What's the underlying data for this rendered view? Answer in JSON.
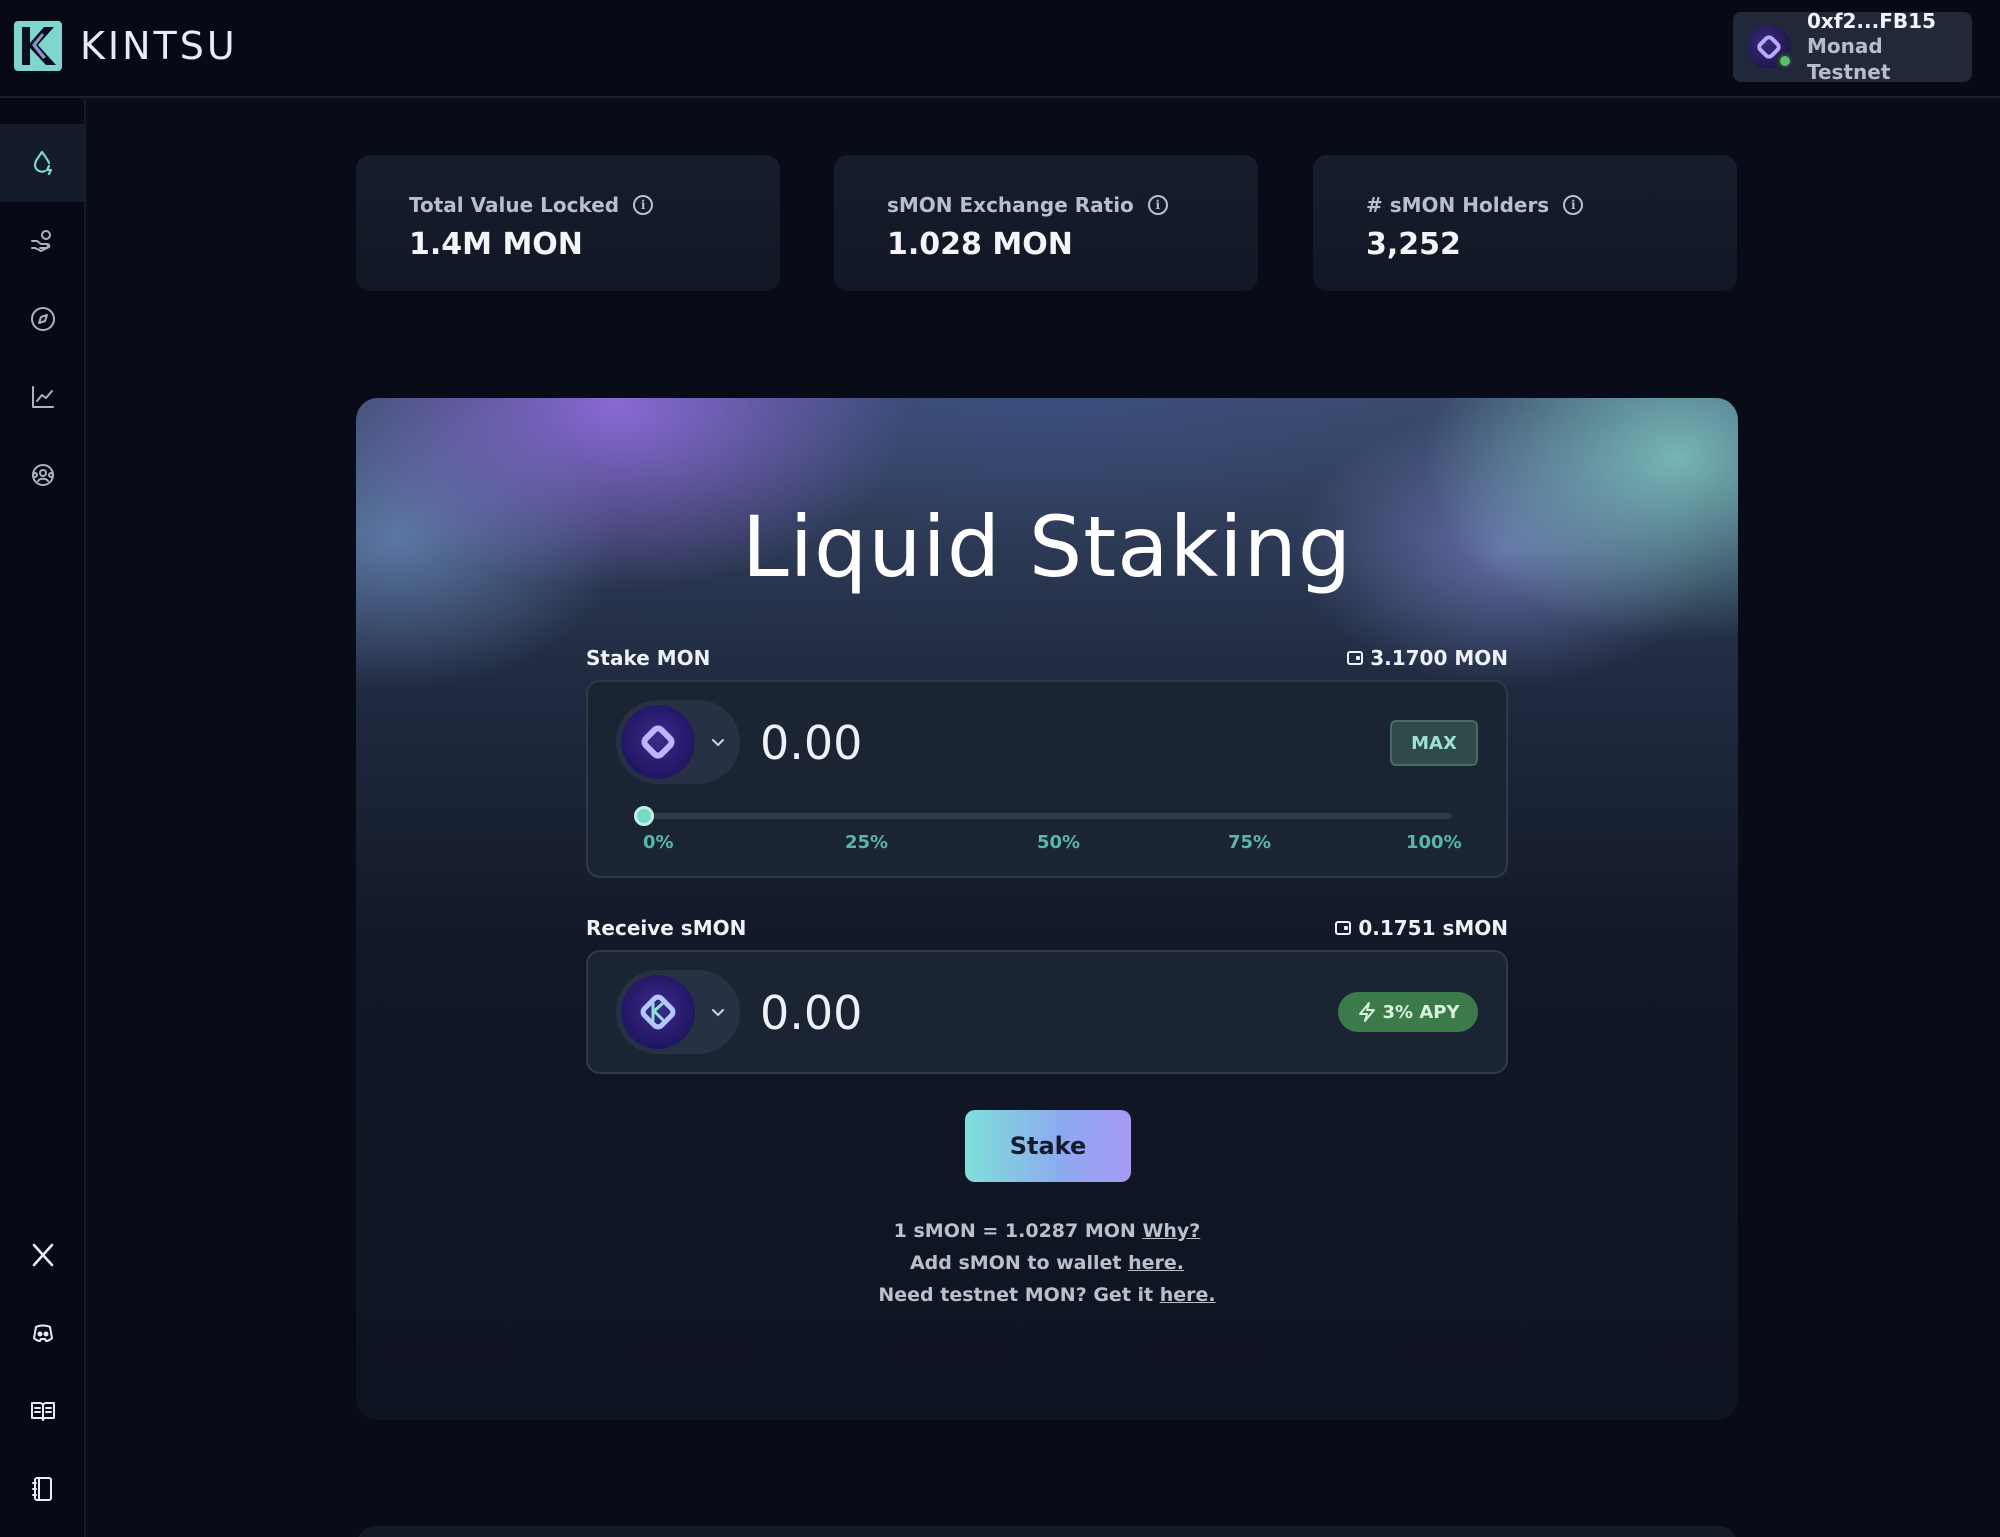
{
  "app": {
    "brand": "KINTSU",
    "wallet": {
      "address": "0xf2...FB15",
      "network": "Monad Testnet"
    }
  },
  "sidebar": {
    "items": [
      {
        "icon": "droplet-icon",
        "active": true
      },
      {
        "icon": "hand-coins-icon",
        "active": false
      },
      {
        "icon": "compass-icon",
        "active": false
      },
      {
        "icon": "chart-line-icon",
        "active": false
      },
      {
        "icon": "community-icon",
        "active": false
      }
    ],
    "social": [
      {
        "icon": "x-twitter-icon"
      },
      {
        "icon": "discord-icon"
      },
      {
        "icon": "book-open-icon"
      },
      {
        "icon": "notebook-icon"
      }
    ]
  },
  "stats": [
    {
      "label": "Total Value Locked",
      "value": "1.4M MON"
    },
    {
      "label": "sMON Exchange Ratio",
      "value": "1.028 MON"
    },
    {
      "label": "# sMON Holders",
      "value": "3,252"
    }
  ],
  "staking": {
    "title": "Liquid Staking",
    "stake": {
      "label": "Stake MON",
      "balance": "3.1700 MON",
      "amount": "0.00",
      "max_label": "MAX",
      "slider_percent": 0,
      "ticks": [
        "0%",
        "25%",
        "50%",
        "75%",
        "100%"
      ]
    },
    "receive": {
      "label": "Receive sMON",
      "balance": "0.1751 sMON",
      "amount": "0.00",
      "apy": "3% APY"
    },
    "button": "Stake",
    "footer": {
      "ratio_text": "1 sMON = 1.0287 MON",
      "why_link": "Why?",
      "add_text": "Add sMON to wallet",
      "add_link": "here.",
      "need_text": "Need testnet MON? Get it",
      "need_link": "here."
    }
  },
  "colors": {
    "background": "#080b18",
    "accent_teal": "#7ad8c6",
    "apy_green": "#3d7a4a",
    "token_purple": "#3c2c8c"
  }
}
